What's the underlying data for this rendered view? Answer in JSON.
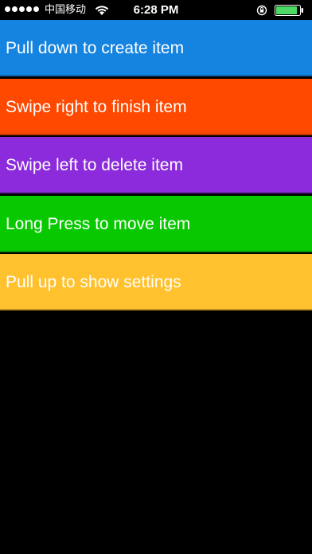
{
  "status_bar": {
    "carrier": "中国移动",
    "time": "6:28 PM",
    "signal_icon": "signal-dots-icon",
    "wifi_icon": "wifi-icon",
    "orientation_icon": "orientation-lock-icon",
    "battery_icon": "battery-icon",
    "battery_level": 0.9
  },
  "items": [
    {
      "label": "Pull down to create item",
      "color": "#1583E0"
    },
    {
      "label": "Swipe right to finish item",
      "color": "#FF4800"
    },
    {
      "label": "Swipe left to delete item",
      "color": "#8B2BDB"
    },
    {
      "label": "Long Press to move item",
      "color": "#08C800"
    },
    {
      "label": "Pull up to show settings",
      "color": "#FFC12D"
    }
  ]
}
